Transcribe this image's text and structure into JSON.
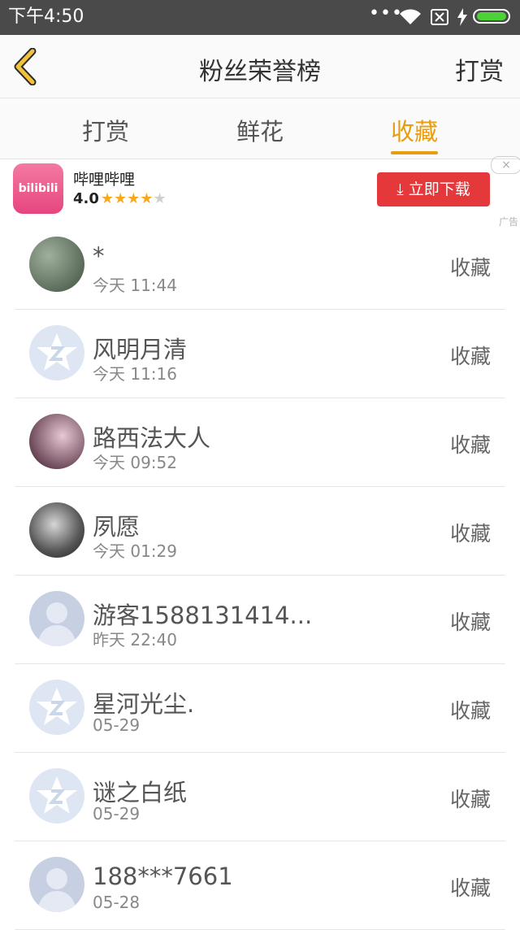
{
  "status_bar": {
    "time": "下午4:50",
    "dots": "•••"
  },
  "header": {
    "title": "粉丝荣誉榜",
    "action": "打赏"
  },
  "tabs": [
    {
      "label": "打赏",
      "active": false
    },
    {
      "label": "鲜花",
      "active": false
    },
    {
      "label": "收藏",
      "active": true
    }
  ],
  "ad": {
    "app_logo_text": "bilibili",
    "app_name": "哔哩哔哩",
    "rating": "4.0",
    "stars": "★★★★",
    "star_empty": "★",
    "download_label": "⤓  立即下载",
    "close": "×",
    "tag": "广告"
  },
  "fans": [
    {
      "name": "*",
      "time": "今天 11:44",
      "action": "收藏"
    },
    {
      "name": "风明月清",
      "time": "今天 11:16",
      "action": "收藏"
    },
    {
      "name": "路西法大人",
      "time": "今天 09:52",
      "action": "收藏"
    },
    {
      "name": "夙愿",
      "time": "今天 01:29",
      "action": "收藏"
    },
    {
      "name": "游客1588131414...",
      "time": "昨天 22:40",
      "action": "收藏"
    },
    {
      "name": "星河光尘.",
      "time": "05-29",
      "action": "收藏"
    },
    {
      "name": "谜之白纸",
      "time": "05-29",
      "action": "收藏"
    },
    {
      "name": "188***7661",
      "time": "05-28",
      "action": "收藏"
    }
  ],
  "colors": {
    "accent": "#e89d10",
    "download": "#e5383b",
    "status_bar": "#4a4a4a"
  }
}
